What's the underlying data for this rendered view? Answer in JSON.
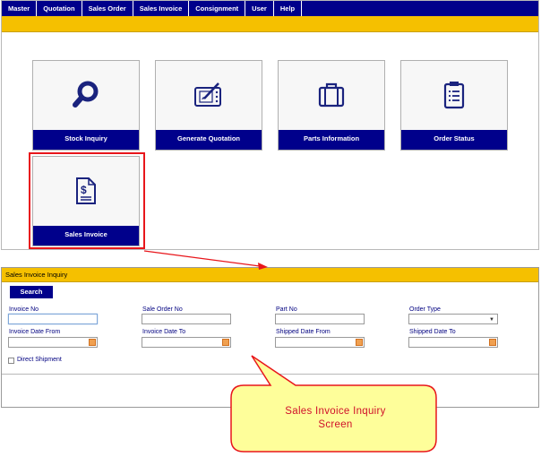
{
  "menu": [
    "Master",
    "Quotation",
    "Sales Order",
    "Sales Invoice",
    "Consignment",
    "User",
    "Help"
  ],
  "tiles": [
    {
      "label": "Stock Inquiry",
      "icon": "magnifier-icon"
    },
    {
      "label": "Generate Quotation",
      "icon": "drawing-tablet-icon"
    },
    {
      "label": "Parts Information",
      "icon": "briefcase-icon"
    },
    {
      "label": "Order Status",
      "icon": "clipboard-icon"
    },
    {
      "label": "Sales Invoice",
      "icon": "dollar-document-icon"
    }
  ],
  "inquiry": {
    "title": "Sales Invoice Inquiry",
    "search_label": "Search",
    "fields": {
      "invoice_no": "Invoice No",
      "sale_order_no": "Sale Order No",
      "part_no": "Part No",
      "order_type": "Order Type",
      "invoice_date_from": "Invoice Date From",
      "invoice_date_to": "Invoice Date To",
      "shipped_date_from": "Shipped Date From",
      "shipped_date_to": "Shipped Date To"
    },
    "direct_shipment": "Direct Shipment"
  },
  "callout": {
    "line1": "Sales Invoice Inquiry",
    "line2": "Screen"
  },
  "colors": {
    "navy": "#00008b",
    "yellow": "#f5c000",
    "highlight_red": "#e8161b",
    "callout_fill": "#fefe9a"
  }
}
